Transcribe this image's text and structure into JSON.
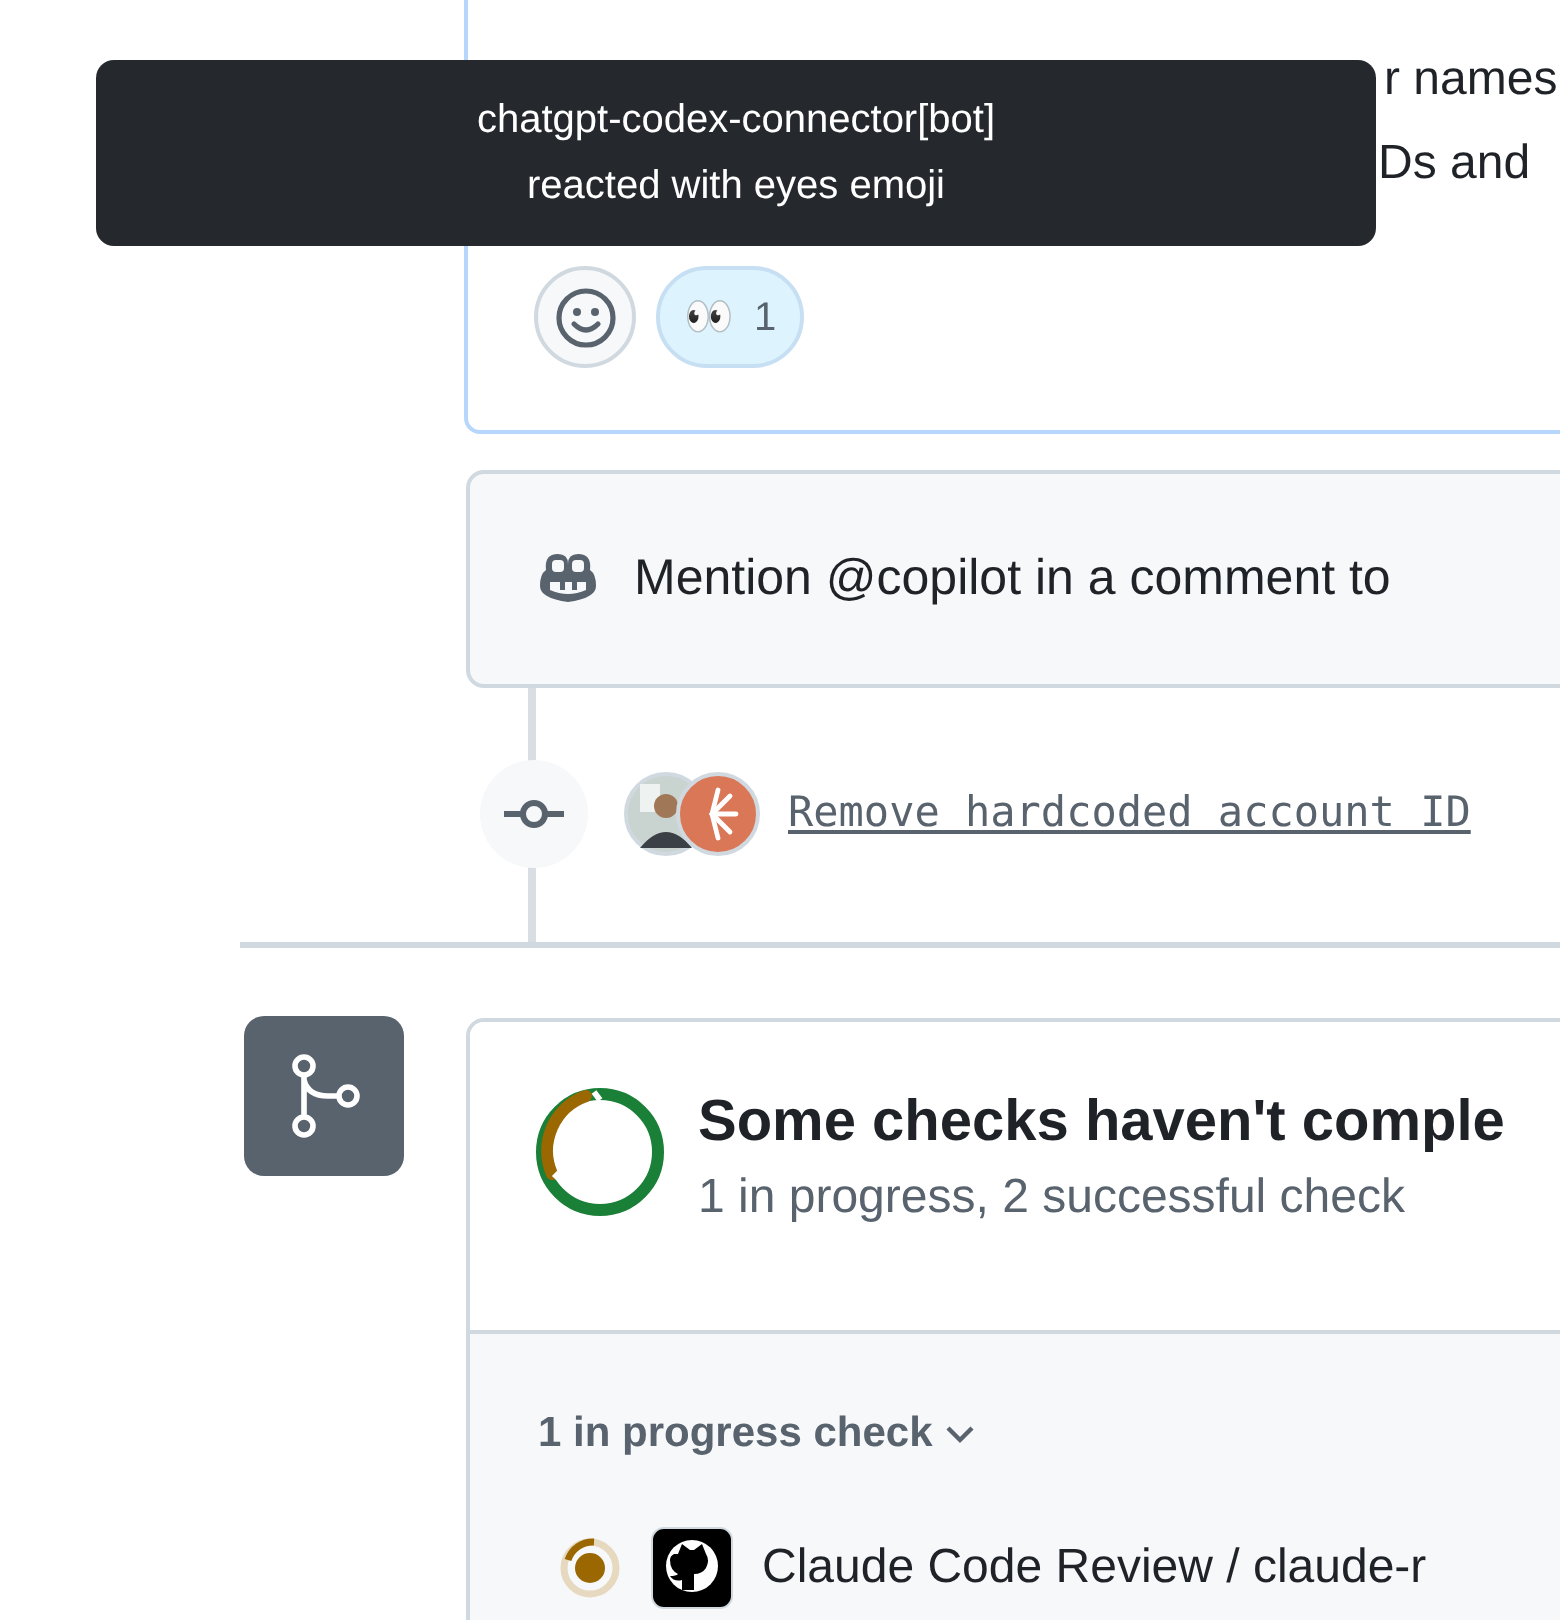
{
  "comment": {
    "body_lines": [
      "r names",
      "Ds and"
    ],
    "reactions": [
      {
        "kind": "add"
      },
      {
        "kind": "emoji",
        "emoji": "👀",
        "count": "1",
        "selected": true
      }
    ]
  },
  "tooltip": {
    "lines": [
      "chatgpt-codex-connector[bot]",
      "reacted with eyes emoji"
    ]
  },
  "copilot_hint": {
    "text": "Mention @copilot in a comment to"
  },
  "commit": {
    "message": "Remove hardcoded account ID"
  },
  "checks": {
    "title": "Some checks haven't comple",
    "summary": "1 in progress, 2 successful check",
    "group": {
      "label": "1 in progress check",
      "expanded": true
    },
    "items": [
      {
        "kind": "in_progress",
        "name": "Claude Code Review / claude-r"
      }
    ]
  }
}
